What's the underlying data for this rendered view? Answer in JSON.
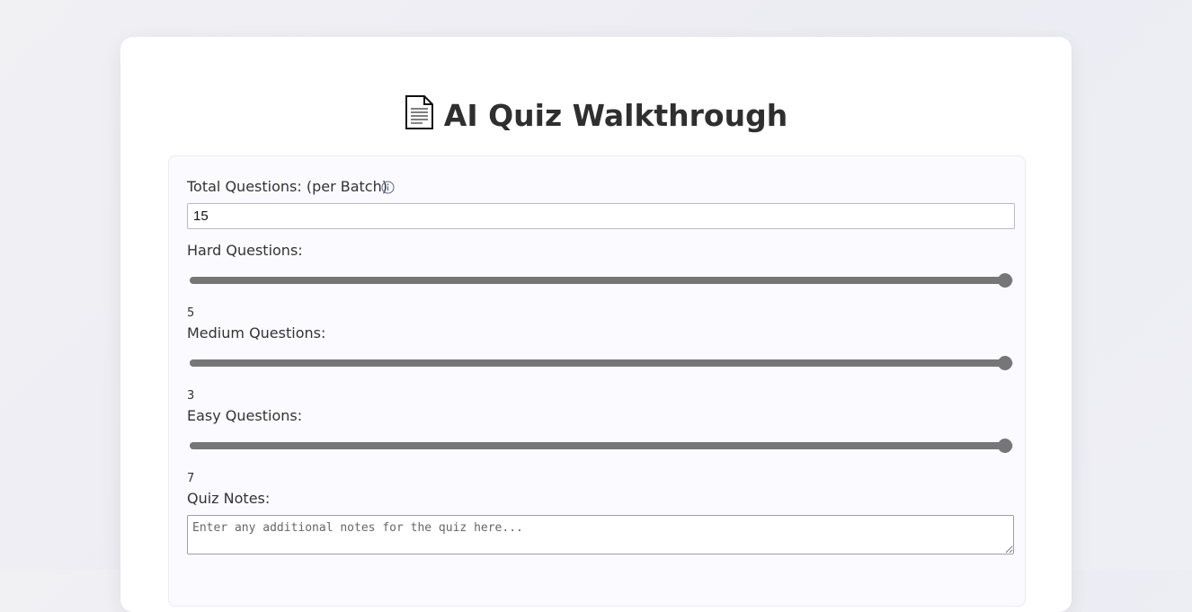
{
  "page": {
    "title": "AI Quiz Walkthrough",
    "title_icon": "document-icon"
  },
  "form": {
    "total_questions": {
      "label": "Total Questions: (per Batch)",
      "info_icon": "info-icon",
      "value": "15"
    },
    "hard": {
      "label": "Hard Questions:",
      "value": "5",
      "fill_fraction": 0.99
    },
    "medium": {
      "label": "Medium Questions:",
      "value": "3",
      "fill_fraction": 0.99
    },
    "easy": {
      "label": "Easy Questions:",
      "value": "7",
      "fill_fraction": 0.99
    },
    "notes": {
      "label": "Quiz Notes:",
      "placeholder": "Enter any additional notes for the quiz here..."
    }
  },
  "colors": {
    "slider_fill": "#767678",
    "card_background": "#ffffff",
    "panel_background": "#fbfaff"
  }
}
